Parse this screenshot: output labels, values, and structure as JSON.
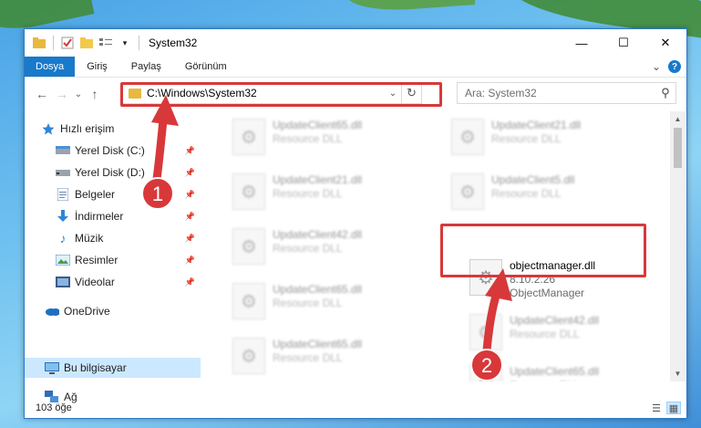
{
  "window": {
    "title": "System32",
    "controls": {
      "minimize": "—",
      "maximize": "☐",
      "close": "✕"
    }
  },
  "ribbon": {
    "tabs": [
      "Dosya",
      "Giriş",
      "Paylaş",
      "Görünüm"
    ],
    "expand_glyph": "⌄",
    "help": "?"
  },
  "navigation": {
    "back": "←",
    "forward": "→",
    "recent": "⌄",
    "up": "↑",
    "address": "C:\\Windows\\System32",
    "address_dropdown": "⌄",
    "refresh": "↻",
    "search_placeholder": "Ara: System32",
    "search_glyph": "⚲"
  },
  "sidebar": {
    "quick_access": "Hızlı erişim",
    "items": [
      {
        "label": "Yerel Disk (C:)",
        "icon": "drive-icon"
      },
      {
        "label": "Yerel Disk (D:)",
        "icon": "drive-icon"
      },
      {
        "label": "Belgeler",
        "icon": "documents-icon"
      },
      {
        "label": "İndirmeler",
        "icon": "download-icon"
      },
      {
        "label": "Müzik",
        "icon": "music-icon"
      },
      {
        "label": "Resimler",
        "icon": "pictures-icon"
      },
      {
        "label": "Videolar",
        "icon": "video-icon"
      }
    ],
    "onedrive": "OneDrive",
    "this_pc": "Bu bilgisayar",
    "network": "Ağ"
  },
  "files": [
    {
      "name": "UpdateClient65.dll",
      "type": "Resource DLL"
    },
    {
      "name": "UpdateClient21.dll",
      "type": "Resource DLL"
    },
    {
      "name": "UpdateClient21.dll",
      "type": "Resource DLL"
    },
    {
      "name": "UpdateClient5.dll",
      "type": "Resource DLL"
    },
    {
      "name": "UpdateClient42.dll",
      "type": "Resource DLL"
    },
    {
      "name": "objectmanager.dll",
      "version": "8.10.2.26",
      "type": "ObjectManager",
      "highlighted": true
    },
    {
      "name": "UpdateClient65.dll",
      "type": "Resource DLL"
    },
    {
      "name": "UpdateClient42.dll",
      "type": "Resource DLL"
    },
    {
      "name": "UpdateClient65.dll",
      "type": "Resource DLL"
    },
    {
      "name": "UpdateClient65.dll",
      "type": "Resource DLL"
    }
  ],
  "annotations": {
    "step1": "1",
    "step2": "2",
    "color": "#d8383a"
  },
  "status": {
    "item_count": "103 öğe"
  },
  "colors": {
    "accent": "#1979ca",
    "selection": "#cce8ff",
    "folder": "#e8b83f"
  }
}
